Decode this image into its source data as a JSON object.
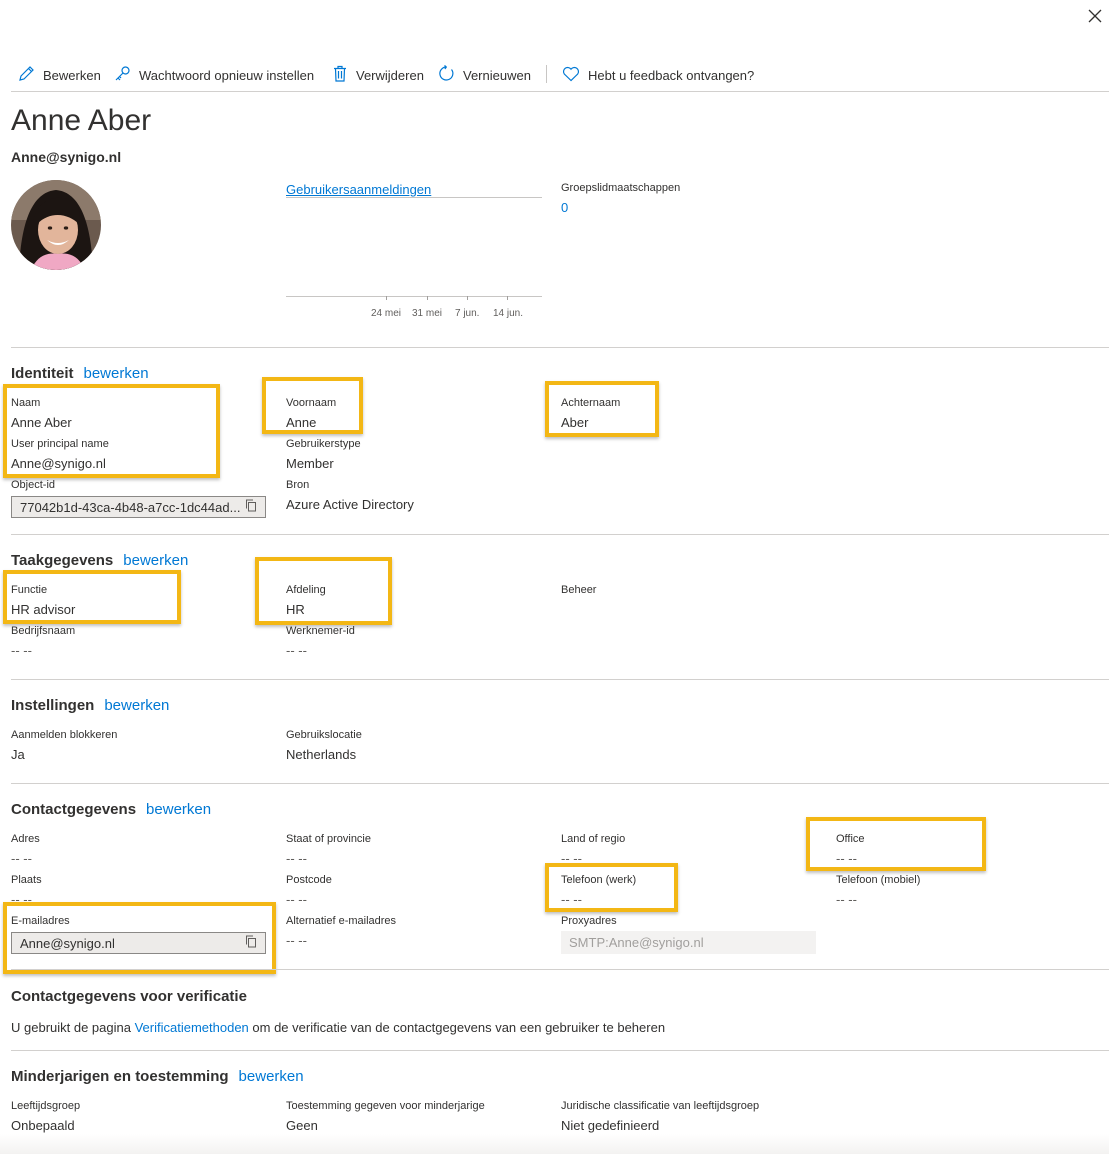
{
  "toolbar": {
    "edit": "Bewerken",
    "reset_password": "Wachtwoord opnieuw instellen",
    "delete": "Verwijderen",
    "refresh": "Vernieuwen",
    "feedback": "Hebt u feedback ontvangen?"
  },
  "user": {
    "display_name": "Anne Aber",
    "upn": "Anne@synigo.nl"
  },
  "overview": {
    "signins_link": "Gebruikersaanmeldingen",
    "chart_ticks": [
      "24 mei",
      "31 mei",
      "7 jun.",
      "14 jun."
    ],
    "groups_label": "Groepslidmaatschappen",
    "groups_count": "0"
  },
  "identity": {
    "title": "Identiteit",
    "edit": "bewerken",
    "name_label": "Naam",
    "name_value": "Anne Aber",
    "first_label": "Voornaam",
    "first_value": "Anne",
    "last_label": "Achternaam",
    "last_value": "Aber",
    "upn_label": "User principal name",
    "upn_value": "Anne@synigo.nl",
    "usertype_label": "Gebruikerstype",
    "usertype_value": "Member",
    "objectid_label": "Object-id",
    "objectid_value": "77042b1d-43ca-4b48-a7cc-1dc44ad...",
    "source_label": "Bron",
    "source_value": "Azure Active Directory"
  },
  "job": {
    "title": "Taakgegevens",
    "edit": "bewerken",
    "function_label": "Functie",
    "function_value": "HR advisor",
    "department_label": "Afdeling",
    "department_value": "HR",
    "manager_label": "Beheer",
    "company_label": "Bedrijfsnaam",
    "company_value": "-- --",
    "employee_label": "Werknemer-id",
    "employee_value": "-- --"
  },
  "settings": {
    "title": "Instellingen",
    "edit": "bewerken",
    "block_label": "Aanmelden blokkeren",
    "block_value": "Ja",
    "location_label": "Gebruikslocatie",
    "location_value": "Netherlands"
  },
  "contact": {
    "title": "Contactgegevens",
    "edit": "bewerken",
    "address_label": "Adres",
    "address_value": "-- --",
    "state_label": "Staat of provincie",
    "state_value": "-- --",
    "country_label": "Land of regio",
    "country_value": "-- --",
    "office_label": "Office",
    "office_value": "-- --",
    "city_label": "Plaats",
    "city_value": "-- --",
    "postal_label": "Postcode",
    "postal_value": "-- --",
    "phone_label": "Telefoon (werk)",
    "phone_value": "-- --",
    "mobile_label": "Telefoon (mobiel)",
    "mobile_value": "-- --",
    "email_label": "E-mailadres",
    "email_value": "Anne@synigo.nl",
    "altemail_label": "Alternatief e-mailadres",
    "altemail_value": "-- --",
    "proxy_label": "Proxyadres",
    "proxy_value": "SMTP:Anne@synigo.nl"
  },
  "verification": {
    "title": "Contactgegevens voor verificatie",
    "text_before": "U gebruikt de pagina ",
    "link": "Verificatiemethoden",
    "text_after": " om de verificatie van de contactgegevens van een gebruiker te beheren"
  },
  "minors": {
    "title": "Minderjarigen en toestemming",
    "edit": "bewerken",
    "age_label": "Leeftijdsgroep",
    "age_value": "Onbepaald",
    "consent_label": "Toestemming gegeven voor minderjarige",
    "consent_value": "Geen",
    "legal_label": "Juridische classificatie van leeftijdsgroep",
    "legal_value": "Niet gedefinieerd"
  },
  "colors": {
    "accent": "#0078d4",
    "highlight": "#f3b715",
    "text": "#323130"
  }
}
